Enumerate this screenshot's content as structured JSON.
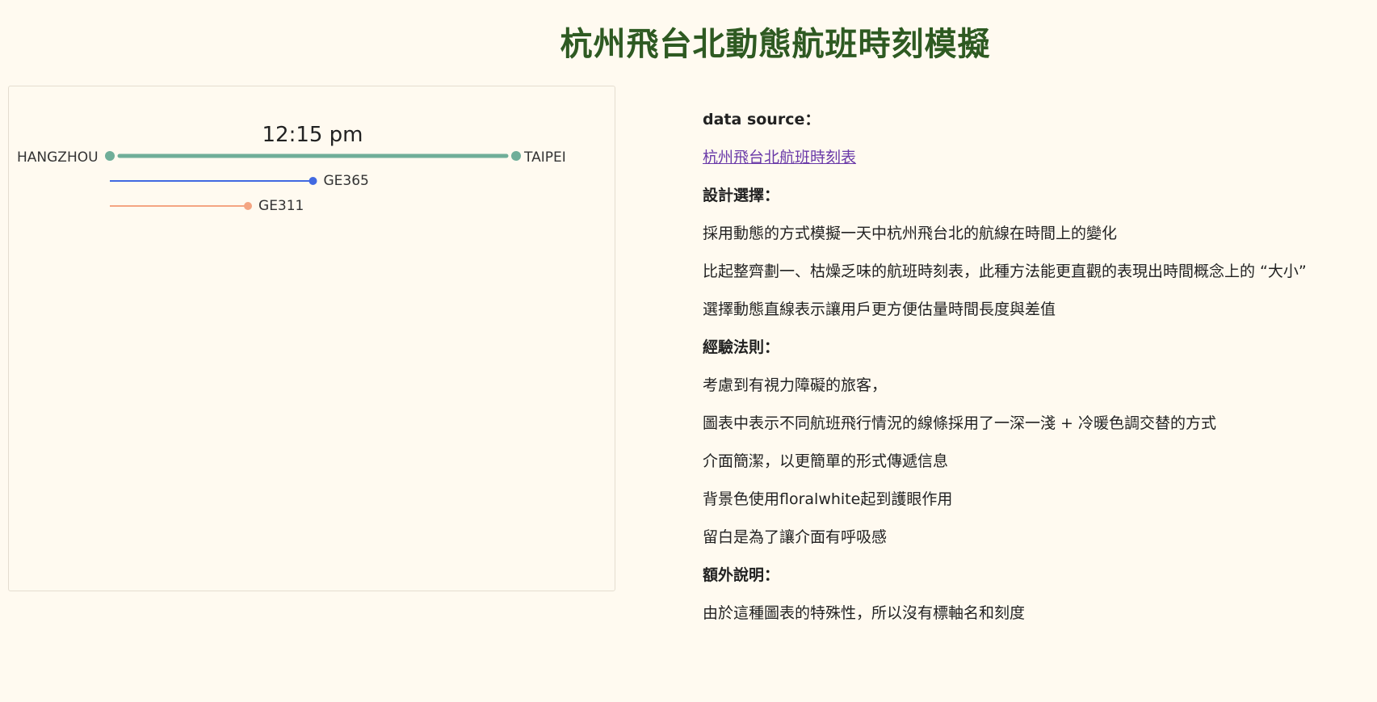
{
  "page": {
    "title": "杭州飛台北動態航班時刻模擬"
  },
  "chart_data": {
    "type": "line",
    "clock": "12:15 pm",
    "origin": "HANGZHOU",
    "destination": "TAIPEI",
    "route_progress": 1.0,
    "series": [
      {
        "name": "GE365",
        "progress": 0.5,
        "color": "#4169e1"
      },
      {
        "name": "GE311",
        "progress": 0.34,
        "color": "#f4a582"
      }
    ],
    "route_color": "#6fae99"
  },
  "info": {
    "data_source_heading": "data source：",
    "data_source_link": "杭州飛台北航班時刻表",
    "design_heading": "設計選擇：",
    "design_lines": [
      "採用動態的方式模擬一天中杭州飛台北的航線在時間上的變化",
      "比起整齊劃一、枯燥乏味的航班時刻表，此種方法能更直觀的表現出時間概念上的 “大小”",
      "選擇動態直線表示讓用戶更方便估量時間長度與差值"
    ],
    "rules_heading": "經驗法則：",
    "rules_lines": [
      "考慮到有視力障礙的旅客，",
      "圖表中表示不同航班飛行情況的線條採用了一深一淺 + 冷暖色調交替的方式",
      "介面簡潔，以更簡單的形式傳遞信息",
      "背景色使用floralwhite起到護眼作用",
      "留白是為了讓介面有呼吸感"
    ],
    "extra_heading": "額外說明：",
    "extra_lines": [
      "由於這種圖表的特殊性，所以沒有標軸名和刻度"
    ]
  }
}
